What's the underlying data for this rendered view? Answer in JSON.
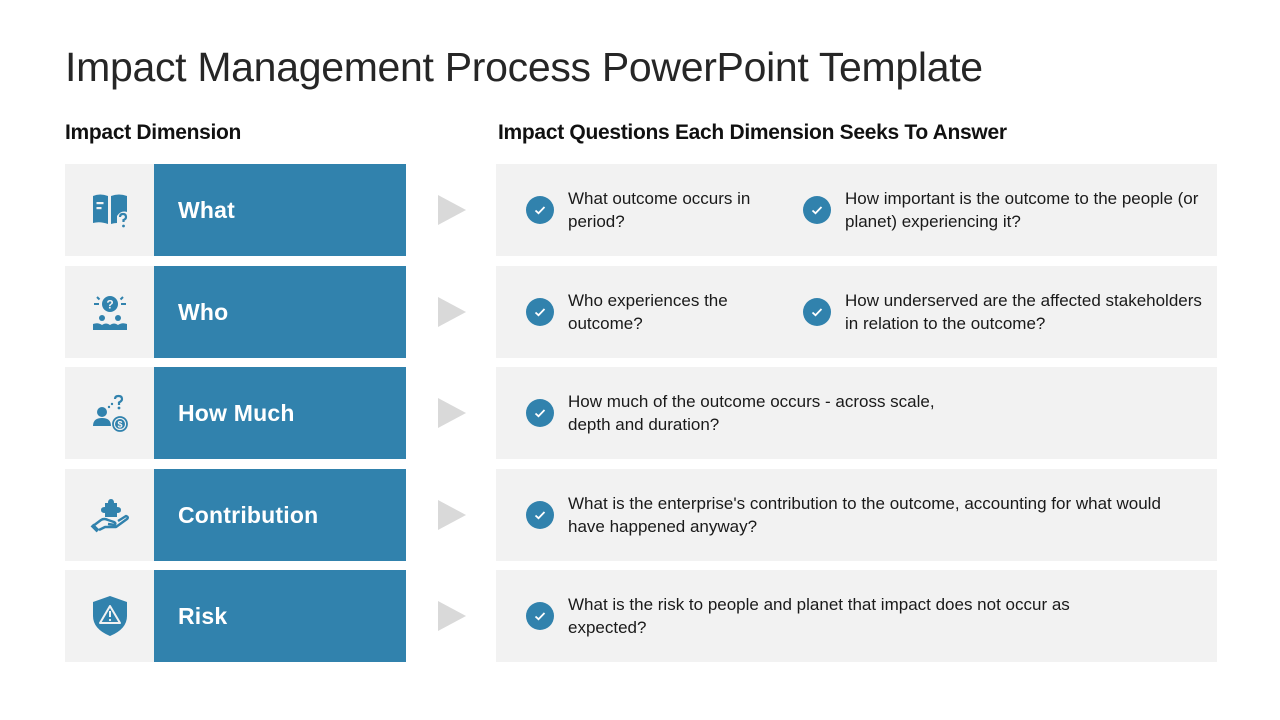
{
  "slide": {
    "title": "Impact Management Process PowerPoint Template",
    "left_heading": "Impact Dimension",
    "right_heading": "Impact Questions Each Dimension Seeks To Answer"
  },
  "colors": {
    "accent": "#3182ad",
    "panel": "#f2f2f2",
    "arrow": "#d9d9d9"
  },
  "rows": [
    {
      "label": "What",
      "icon": "book-question-icon",
      "questions": [
        "What outcome occurs in period?",
        "How important is the outcome to the people (or planet) experiencing it?"
      ]
    },
    {
      "label": "Who",
      "icon": "people-question-icon",
      "questions": [
        "Who experiences the outcome?",
        "How underserved are the affected stakeholders in relation to the outcome?"
      ]
    },
    {
      "label": "How Much",
      "icon": "person-dollar-question-icon",
      "questions": [
        "How much of the outcome occurs - across scale, depth and duration?"
      ]
    },
    {
      "label": "Contribution",
      "icon": "hand-puzzle-icon",
      "questions": [
        "What is the enterprise's contribution to the outcome, accounting for what would have happened anyway?"
      ]
    },
    {
      "label": "Risk",
      "icon": "shield-warning-icon",
      "questions": [
        "What is the risk to people and planet that impact does not occur as expected?"
      ]
    }
  ]
}
